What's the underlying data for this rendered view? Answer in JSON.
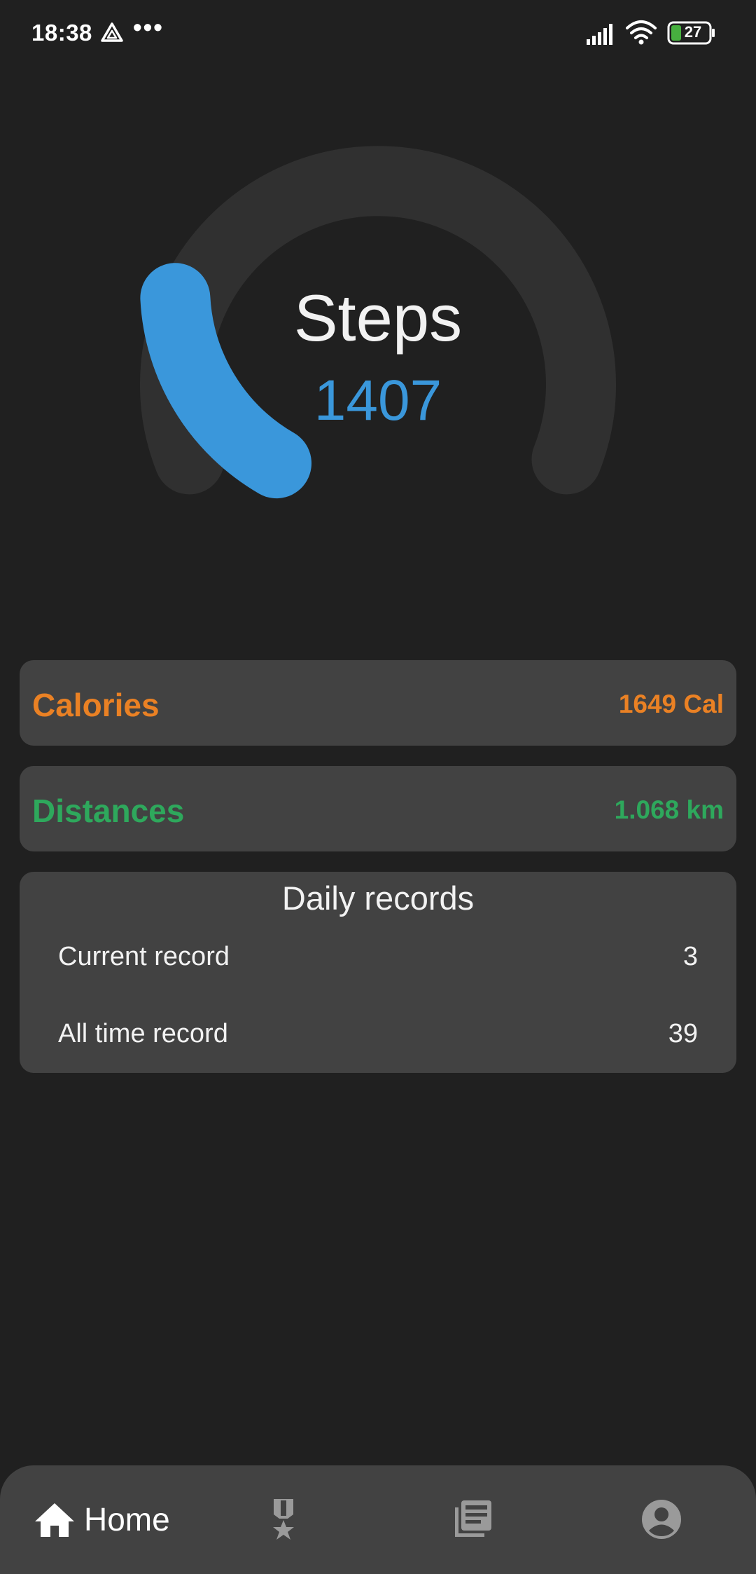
{
  "status_bar": {
    "time": "18:38",
    "dots": "•••",
    "battery_level": "27",
    "icons": [
      "drive-icon",
      "signal-icon",
      "wifi-icon",
      "battery-icon"
    ]
  },
  "gauge": {
    "label": "Steps",
    "value": "1407",
    "fill_fraction": 0.19,
    "track_color": "#303030",
    "fill_color": "#3a97db"
  },
  "stats": {
    "calories": {
      "label": "Calories",
      "value": "1649 Cal",
      "color": "#ea8124"
    },
    "distances": {
      "label": "Distances",
      "value": "1.068 km",
      "color": "#2ea85c"
    }
  },
  "records": {
    "title": "Daily records",
    "rows": [
      {
        "label": "Current record",
        "value": "3"
      },
      {
        "label": "All time record",
        "value": "39"
      }
    ]
  },
  "bottom_nav": {
    "items": [
      {
        "label": "Home",
        "icon": "home-icon",
        "active": true
      },
      {
        "label": "",
        "icon": "medal-icon",
        "active": false
      },
      {
        "label": "",
        "icon": "news-icon",
        "active": false
      },
      {
        "label": "",
        "icon": "profile-icon",
        "active": false
      }
    ]
  }
}
